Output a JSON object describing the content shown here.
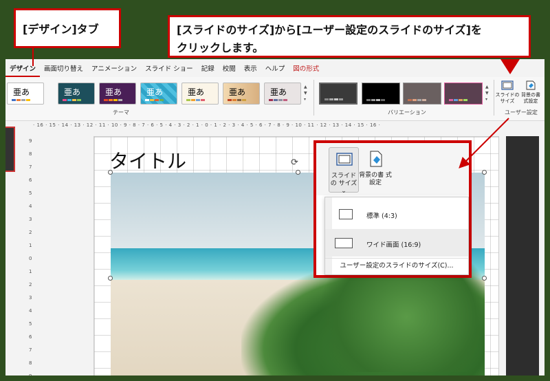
{
  "annotations": {
    "design_tab_note": "[デザイン]タブ",
    "instruction_line1": "[スライドのサイズ]から[ユーザー設定のスライドのサイズ]を",
    "instruction_line2": "クリックします。"
  },
  "ribbon": {
    "tabs": [
      "デザイン",
      "画面切り替え",
      "アニメーション",
      "スライド ショー",
      "記録",
      "校閲",
      "表示",
      "ヘルプ",
      "図の形式"
    ],
    "active_tab": "デザイン",
    "theme_sample_text": "亜あ",
    "theme_group_label": "テーマ",
    "variation_group_label": "バリエーション",
    "customize_group_label": "ユーザー設定",
    "slide_size_label": "スライドの サイズ",
    "bg_format_label": "背景の書 式設定"
  },
  "ruler": {
    "horizontal": "· 16 · 15 · 14 · 13 · 12 · 11 · 10 · 9 · 8 · 7 · 6 · 5 · 4 · 3 · 2 · 1 · 0 · 1 · 2 · 3 · 4 · 5 · 6 · 7 · 8 · 9 · 10 · 11 · 12 · 13 · 14 · 15 · 16 ·",
    "vertical": [
      "9",
      "8",
      "7",
      "6",
      "5",
      "4",
      "3",
      "2",
      "1",
      "0",
      "1",
      "2",
      "3",
      "4",
      "5",
      "6",
      "7",
      "8",
      "9"
    ]
  },
  "slide": {
    "title": "タイトル"
  },
  "callout": {
    "slide_size_button": "スライドの サイズ",
    "slide_size_chevron": "⌄",
    "bg_format_button": "背景の書 式設定",
    "options": [
      {
        "label": "標準 (4:3)"
      },
      {
        "label": "ワイド画面 (16:9)"
      }
    ],
    "custom_size": "ユーザー設定のスライドのサイズ(C)..."
  },
  "colors": {
    "annotation_border": "#c00000",
    "background": "#2f4f1f"
  }
}
